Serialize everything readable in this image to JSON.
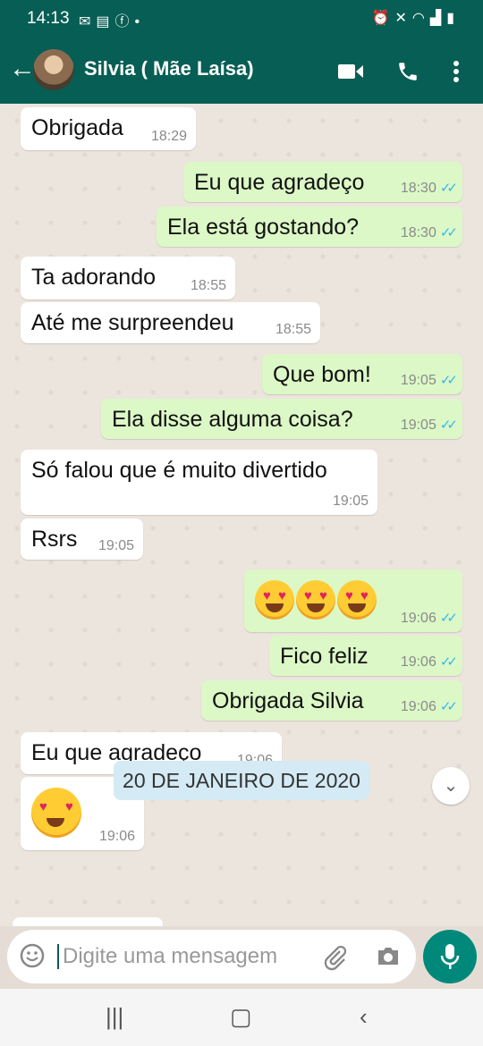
{
  "status_bar": {
    "time": "14:13",
    "left_icons": [
      "mail-icon",
      "message-icon",
      "facebook-icon",
      "dot-icon"
    ],
    "right_icons": [
      "alarm-icon",
      "mute-icon",
      "wifi-icon",
      "signal-icon",
      "battery-icon"
    ]
  },
  "header": {
    "contact_name": "Silvia ( Mãe Laísa)",
    "icons": [
      "back-arrow-icon",
      "video-call-icon",
      "phone-icon",
      "more-vert-icon"
    ]
  },
  "messages": [
    {
      "dir": "in",
      "text": "Obrigada",
      "time": "18:29"
    },
    {
      "dir": "out",
      "text": "Eu que agradeço",
      "time": "18:30",
      "read": true
    },
    {
      "dir": "out",
      "text": "Ela está gostando?",
      "time": "18:30",
      "read": true
    },
    {
      "dir": "in",
      "text": "Ta adorando",
      "time": "18:55"
    },
    {
      "dir": "in",
      "text": "Até me surpreendeu",
      "time": "18:55"
    },
    {
      "dir": "out",
      "text": "Que bom!",
      "time": "19:05",
      "read": true
    },
    {
      "dir": "out",
      "text": "Ela disse alguma coisa?",
      "time": "19:05",
      "read": true
    },
    {
      "dir": "in",
      "text": "Só falou que é muito divertido",
      "time": "19:05"
    },
    {
      "dir": "in",
      "text": "Rsrs",
      "time": "19:05"
    },
    {
      "dir": "out",
      "text": "",
      "emoji": "heart-eyes-emoji x3",
      "time": "19:06",
      "read": true
    },
    {
      "dir": "out",
      "text": "Fico feliz",
      "time": "19:06",
      "read": true
    },
    {
      "dir": "out",
      "text": "Obrigada Silvia",
      "time": "19:06",
      "read": true
    },
    {
      "dir": "in",
      "text": "Eu que agradeço",
      "time": "19:06"
    },
    {
      "dir": "in",
      "text": "",
      "emoji": "heart-eyes-emoji",
      "time": "19:06"
    }
  ],
  "date_chip": "20 DE JANEIRO DE 2020",
  "input": {
    "placeholder": "Digite uma mensagem"
  },
  "colors": {
    "header": "#075e54",
    "outgoing_bubble": "#dcf8c6",
    "incoming_bubble": "#ffffff",
    "read_ticks": "#34b7f1",
    "mic_button": "#00897b"
  }
}
